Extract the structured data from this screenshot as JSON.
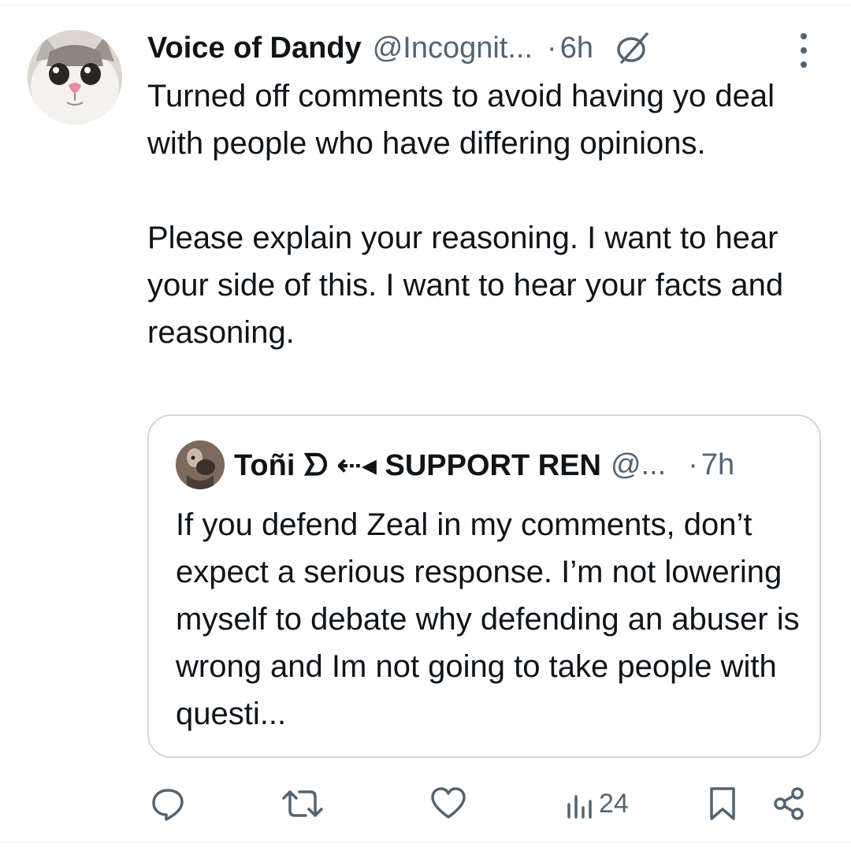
{
  "tweet": {
    "display_name": "Voice of Dandy",
    "handle": "@Incognit...",
    "separator": "·",
    "time": "6h",
    "icons": {
      "avatar": "cat-avatar",
      "reply_restricted": "no-reply-icon",
      "more": "more-options-icon"
    },
    "paragraphs": [
      "Turned off comments to avoid having yo deal with people who have differing opinions.",
      "Please explain your reasoning. I want to hear your side of this. I want to hear your facts and reasoning."
    ]
  },
  "quote": {
    "display_name": "Toñi ᗤ ⇠◂ SUPPORT REN",
    "handle": "@...",
    "separator": "·",
    "time": "7h",
    "text": "If you defend Zeal in my comments, don’t expect a serious response. I’m not lowering myself to debate why defending an abuser is wrong and Im not going to take people with questi..."
  },
  "actions": {
    "reply": {
      "icon": "reply-icon"
    },
    "retweet": {
      "icon": "retweet-icon"
    },
    "like": {
      "icon": "heart-icon"
    },
    "views": {
      "icon": "views-icon",
      "count": "24"
    },
    "bookmark": {
      "icon": "bookmark-icon"
    },
    "share": {
      "icon": "share-icon"
    }
  },
  "colors": {
    "text": "#0f1419",
    "secondary": "#536471",
    "border": "#cfd9de"
  }
}
